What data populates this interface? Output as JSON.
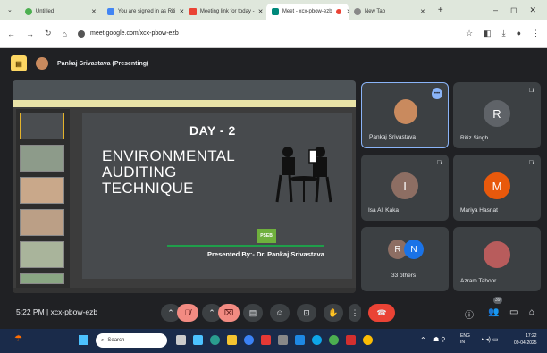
{
  "browser": {
    "tabs": [
      {
        "title": "Untitled",
        "active": false
      },
      {
        "title": "You are signed in as Riti",
        "active": false
      },
      {
        "title": "Meeting link for today - ",
        "active": false
      },
      {
        "title": "Meet - xcx-pbow-ezb",
        "active": true
      },
      {
        "title": "New Tab",
        "active": false
      }
    ],
    "url": "meet.google.com/xcx-pbow-ezb"
  },
  "meet": {
    "presenter_label": "Pankaj Srivastava (Presenting)",
    "slide": {
      "day": "DAY - 2",
      "title_lines": [
        "ENVIRONMENTAL",
        "AUDITING",
        "TECHNIQUE"
      ],
      "presented_by": "Presented By:- Dr. Pankaj Srivastava",
      "logo_text": "PSEB"
    },
    "participants": [
      {
        "name": "Pankaj Srivastava",
        "initial": "",
        "color": "#c98a5e"
      },
      {
        "name": "Ritiz Singh",
        "initial": "R",
        "color": "#5f6368"
      },
      {
        "name": "Isa Ali Kaka",
        "initial": "I",
        "color": "#8d6e63"
      },
      {
        "name": "Mariya Hasnat",
        "initial": "M",
        "color": "#e8590c"
      },
      {
        "name": "33 others",
        "initial": "",
        "color": "#3c4043"
      },
      {
        "name": "Azram Tahoor",
        "initial": "",
        "color": "#b85c5c"
      }
    ],
    "others_avatars": [
      "R",
      "N"
    ],
    "time": "5:22 PM",
    "meeting_code": "xcx-pbow-ezb",
    "people_count": "39"
  },
  "taskbar": {
    "search_placeholder": "Search",
    "lang": "ENG\nIN",
    "clock_time": "17:22",
    "clock_date": "09-04-2025"
  }
}
